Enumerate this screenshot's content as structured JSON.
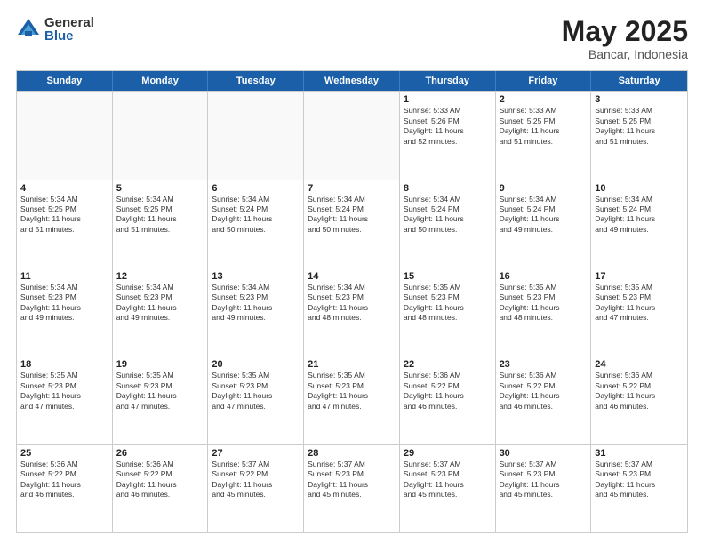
{
  "logo": {
    "general": "General",
    "blue": "Blue"
  },
  "header": {
    "month_year": "May 2025",
    "location": "Bancar, Indonesia"
  },
  "weekdays": [
    "Sunday",
    "Monday",
    "Tuesday",
    "Wednesday",
    "Thursday",
    "Friday",
    "Saturday"
  ],
  "rows": [
    [
      {
        "day": "",
        "text": "",
        "empty": true
      },
      {
        "day": "",
        "text": "",
        "empty": true
      },
      {
        "day": "",
        "text": "",
        "empty": true
      },
      {
        "day": "",
        "text": "",
        "empty": true
      },
      {
        "day": "1",
        "text": "Sunrise: 5:33 AM\nSunset: 5:26 PM\nDaylight: 11 hours\nand 52 minutes.",
        "empty": false
      },
      {
        "day": "2",
        "text": "Sunrise: 5:33 AM\nSunset: 5:25 PM\nDaylight: 11 hours\nand 51 minutes.",
        "empty": false
      },
      {
        "day": "3",
        "text": "Sunrise: 5:33 AM\nSunset: 5:25 PM\nDaylight: 11 hours\nand 51 minutes.",
        "empty": false
      }
    ],
    [
      {
        "day": "4",
        "text": "Sunrise: 5:34 AM\nSunset: 5:25 PM\nDaylight: 11 hours\nand 51 minutes.",
        "empty": false
      },
      {
        "day": "5",
        "text": "Sunrise: 5:34 AM\nSunset: 5:25 PM\nDaylight: 11 hours\nand 51 minutes.",
        "empty": false
      },
      {
        "day": "6",
        "text": "Sunrise: 5:34 AM\nSunset: 5:24 PM\nDaylight: 11 hours\nand 50 minutes.",
        "empty": false
      },
      {
        "day": "7",
        "text": "Sunrise: 5:34 AM\nSunset: 5:24 PM\nDaylight: 11 hours\nand 50 minutes.",
        "empty": false
      },
      {
        "day": "8",
        "text": "Sunrise: 5:34 AM\nSunset: 5:24 PM\nDaylight: 11 hours\nand 50 minutes.",
        "empty": false
      },
      {
        "day": "9",
        "text": "Sunrise: 5:34 AM\nSunset: 5:24 PM\nDaylight: 11 hours\nand 49 minutes.",
        "empty": false
      },
      {
        "day": "10",
        "text": "Sunrise: 5:34 AM\nSunset: 5:24 PM\nDaylight: 11 hours\nand 49 minutes.",
        "empty": false
      }
    ],
    [
      {
        "day": "11",
        "text": "Sunrise: 5:34 AM\nSunset: 5:23 PM\nDaylight: 11 hours\nand 49 minutes.",
        "empty": false
      },
      {
        "day": "12",
        "text": "Sunrise: 5:34 AM\nSunset: 5:23 PM\nDaylight: 11 hours\nand 49 minutes.",
        "empty": false
      },
      {
        "day": "13",
        "text": "Sunrise: 5:34 AM\nSunset: 5:23 PM\nDaylight: 11 hours\nand 49 minutes.",
        "empty": false
      },
      {
        "day": "14",
        "text": "Sunrise: 5:34 AM\nSunset: 5:23 PM\nDaylight: 11 hours\nand 48 minutes.",
        "empty": false
      },
      {
        "day": "15",
        "text": "Sunrise: 5:35 AM\nSunset: 5:23 PM\nDaylight: 11 hours\nand 48 minutes.",
        "empty": false
      },
      {
        "day": "16",
        "text": "Sunrise: 5:35 AM\nSunset: 5:23 PM\nDaylight: 11 hours\nand 48 minutes.",
        "empty": false
      },
      {
        "day": "17",
        "text": "Sunrise: 5:35 AM\nSunset: 5:23 PM\nDaylight: 11 hours\nand 47 minutes.",
        "empty": false
      }
    ],
    [
      {
        "day": "18",
        "text": "Sunrise: 5:35 AM\nSunset: 5:23 PM\nDaylight: 11 hours\nand 47 minutes.",
        "empty": false
      },
      {
        "day": "19",
        "text": "Sunrise: 5:35 AM\nSunset: 5:23 PM\nDaylight: 11 hours\nand 47 minutes.",
        "empty": false
      },
      {
        "day": "20",
        "text": "Sunrise: 5:35 AM\nSunset: 5:23 PM\nDaylight: 11 hours\nand 47 minutes.",
        "empty": false
      },
      {
        "day": "21",
        "text": "Sunrise: 5:35 AM\nSunset: 5:23 PM\nDaylight: 11 hours\nand 47 minutes.",
        "empty": false
      },
      {
        "day": "22",
        "text": "Sunrise: 5:36 AM\nSunset: 5:22 PM\nDaylight: 11 hours\nand 46 minutes.",
        "empty": false
      },
      {
        "day": "23",
        "text": "Sunrise: 5:36 AM\nSunset: 5:22 PM\nDaylight: 11 hours\nand 46 minutes.",
        "empty": false
      },
      {
        "day": "24",
        "text": "Sunrise: 5:36 AM\nSunset: 5:22 PM\nDaylight: 11 hours\nand 46 minutes.",
        "empty": false
      }
    ],
    [
      {
        "day": "25",
        "text": "Sunrise: 5:36 AM\nSunset: 5:22 PM\nDaylight: 11 hours\nand 46 minutes.",
        "empty": false
      },
      {
        "day": "26",
        "text": "Sunrise: 5:36 AM\nSunset: 5:22 PM\nDaylight: 11 hours\nand 46 minutes.",
        "empty": false
      },
      {
        "day": "27",
        "text": "Sunrise: 5:37 AM\nSunset: 5:22 PM\nDaylight: 11 hours\nand 45 minutes.",
        "empty": false
      },
      {
        "day": "28",
        "text": "Sunrise: 5:37 AM\nSunset: 5:23 PM\nDaylight: 11 hours\nand 45 minutes.",
        "empty": false
      },
      {
        "day": "29",
        "text": "Sunrise: 5:37 AM\nSunset: 5:23 PM\nDaylight: 11 hours\nand 45 minutes.",
        "empty": false
      },
      {
        "day": "30",
        "text": "Sunrise: 5:37 AM\nSunset: 5:23 PM\nDaylight: 11 hours\nand 45 minutes.",
        "empty": false
      },
      {
        "day": "31",
        "text": "Sunrise: 5:37 AM\nSunset: 5:23 PM\nDaylight: 11 hours\nand 45 minutes.",
        "empty": false
      }
    ]
  ]
}
